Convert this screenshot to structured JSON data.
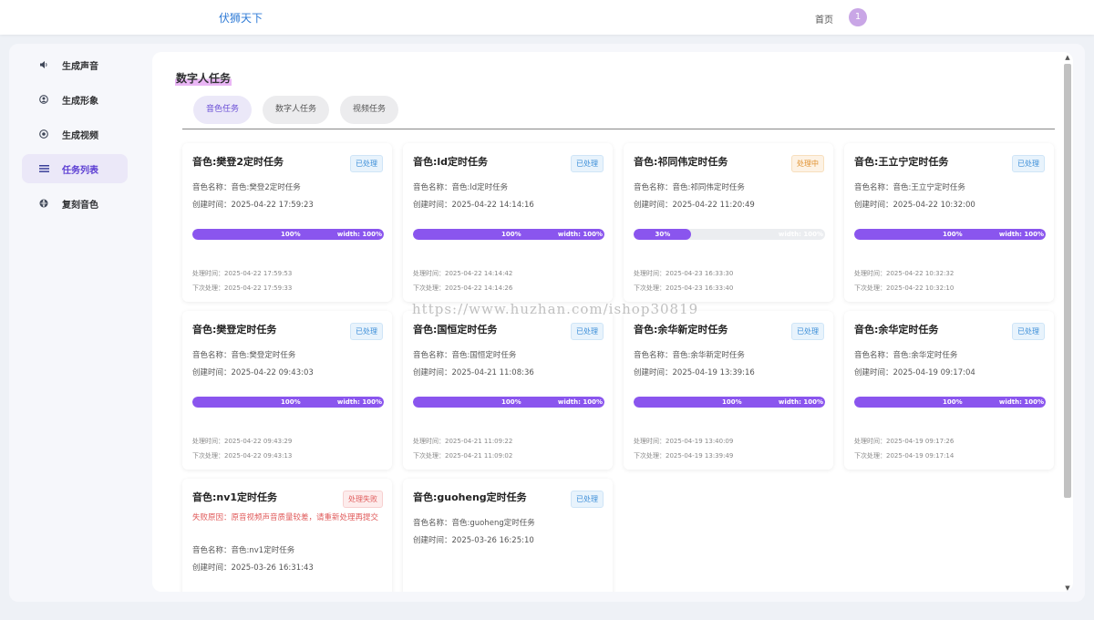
{
  "header": {
    "brand": "伏狮天下",
    "home": "首页",
    "avatar": "1"
  },
  "sidebar": {
    "items": [
      {
        "label": "生成声音",
        "icon": "speaker-icon"
      },
      {
        "label": "生成形象",
        "icon": "user-icon"
      },
      {
        "label": "生成视频",
        "icon": "video-icon"
      },
      {
        "label": "任务列表",
        "icon": "list-icon"
      },
      {
        "label": "复刻音色",
        "icon": "clone-icon"
      }
    ],
    "active": 3
  },
  "main": {
    "title": "数字人任务",
    "tabs": [
      "音色任务",
      "数字人任务",
      "视频任务"
    ],
    "active_tab": 0
  },
  "labels": {
    "voice_name": "音色名称：",
    "created": "创建时间：",
    "processed": "处理时间：",
    "next": "下次处理：",
    "width_text": "width: 100%"
  },
  "tasks": [
    {
      "title": "音色:樊登2定时任务",
      "status": "已处理",
      "status_type": "done",
      "voice": "音色:樊登2定时任务",
      "created": "2025-04-22 17:59:23",
      "progress": 100,
      "processed": "2025-04-22 17:59:53",
      "next": "2025-04-22 17:59:33"
    },
    {
      "title": "音色:ld定时任务",
      "status": "已处理",
      "status_type": "done",
      "voice": "音色:ld定时任务",
      "created": "2025-04-22 14:14:16",
      "progress": 100,
      "processed": "2025-04-22 14:14:42",
      "next": "2025-04-22 14:14:26"
    },
    {
      "title": "音色:祁同伟定时任务",
      "status": "处理中",
      "status_type": "proc",
      "voice": "音色:祁同伟定时任务",
      "created": "2025-04-22 11:20:49",
      "progress": 30,
      "processed": "2025-04-23 16:33:30",
      "next": "2025-04-23 16:33:40"
    },
    {
      "title": "音色:王立宁定时任务",
      "status": "已处理",
      "status_type": "done",
      "voice": "音色:王立宁定时任务",
      "created": "2025-04-22 10:32:00",
      "progress": 100,
      "processed": "2025-04-22 10:32:32",
      "next": "2025-04-22 10:32:10"
    },
    {
      "title": "音色:樊登定时任务",
      "status": "已处理",
      "status_type": "done",
      "voice": "音色:樊登定时任务",
      "created": "2025-04-22 09:43:03",
      "progress": 100,
      "processed": "2025-04-22 09:43:29",
      "next": "2025-04-22 09:43:13"
    },
    {
      "title": "音色:国恒定时任务",
      "status": "已处理",
      "status_type": "done",
      "voice": "音色:国恒定时任务",
      "created": "2025-04-21 11:08:36",
      "progress": 100,
      "processed": "2025-04-21 11:09:22",
      "next": "2025-04-21 11:09:02"
    },
    {
      "title": "音色:余华新定时任务",
      "status": "已处理",
      "status_type": "done",
      "voice": "音色:余华新定时任务",
      "created": "2025-04-19 13:39:16",
      "progress": 100,
      "processed": "2025-04-19 13:40:09",
      "next": "2025-04-19 13:39:49"
    },
    {
      "title": "音色:余华定时任务",
      "status": "已处理",
      "status_type": "done",
      "voice": "音色:余华定时任务",
      "created": "2025-04-19 09:17:04",
      "progress": 100,
      "processed": "2025-04-19 09:17:26",
      "next": "2025-04-19 09:17:14"
    },
    {
      "title": "音色:nv1定时任务",
      "status": "处理失败",
      "status_type": "fail",
      "fail_reason": "失败原因：原音视频声音质量较差，请重新处理再提交",
      "voice": "音色:nv1定时任务",
      "created": "2025-03-26 16:31:43"
    },
    {
      "title": "音色:guoheng定时任务",
      "status": "已处理",
      "status_type": "done",
      "voice": "音色:guoheng定时任务",
      "created": "2025-03-26 16:25:10"
    }
  ],
  "watermark": "https://www.huzhan.com/ishop30819",
  "colors": {
    "accent": "#8a55ee",
    "brand": "#2f7bd6",
    "done": "#3b8ed8",
    "processing": "#e0912f",
    "failed": "#e05b5b"
  }
}
